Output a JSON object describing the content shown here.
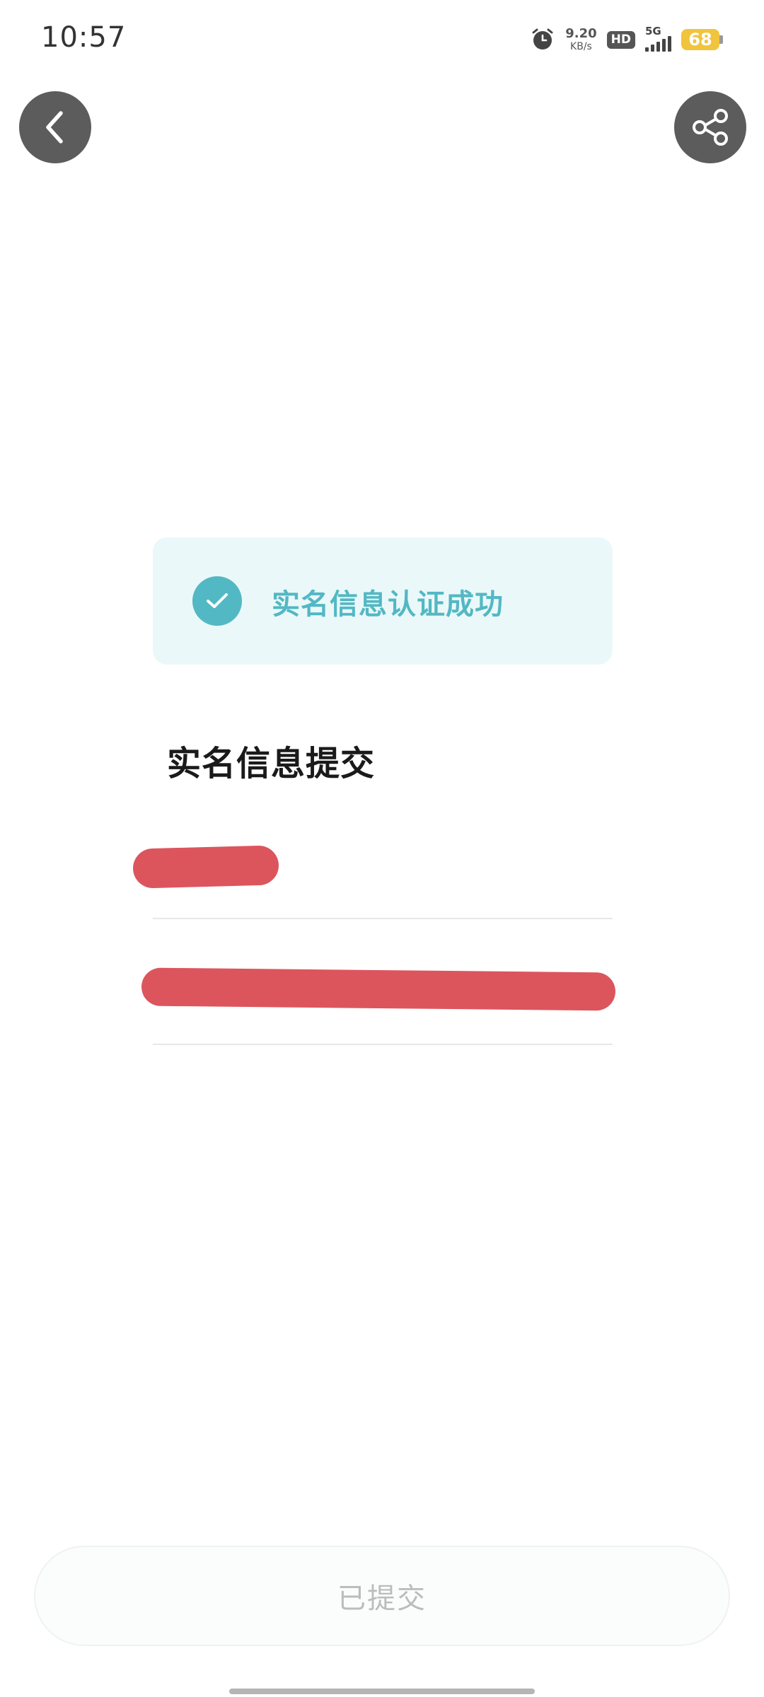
{
  "status_bar": {
    "time": "10:57",
    "net_speed_value": "9.20",
    "net_speed_unit": "KB/s",
    "hd_label": "HD",
    "network_label": "5G",
    "battery_level": "68",
    "battery_color": "#f0c43c"
  },
  "nav": {
    "back_icon": "chevron-left-icon",
    "share_icon": "share-icon"
  },
  "success_banner": {
    "text": "实名信息认证成功",
    "accent_color": "#52b8c4"
  },
  "section": {
    "title": "实名信息提交"
  },
  "submit_button": {
    "label": "已提交"
  }
}
